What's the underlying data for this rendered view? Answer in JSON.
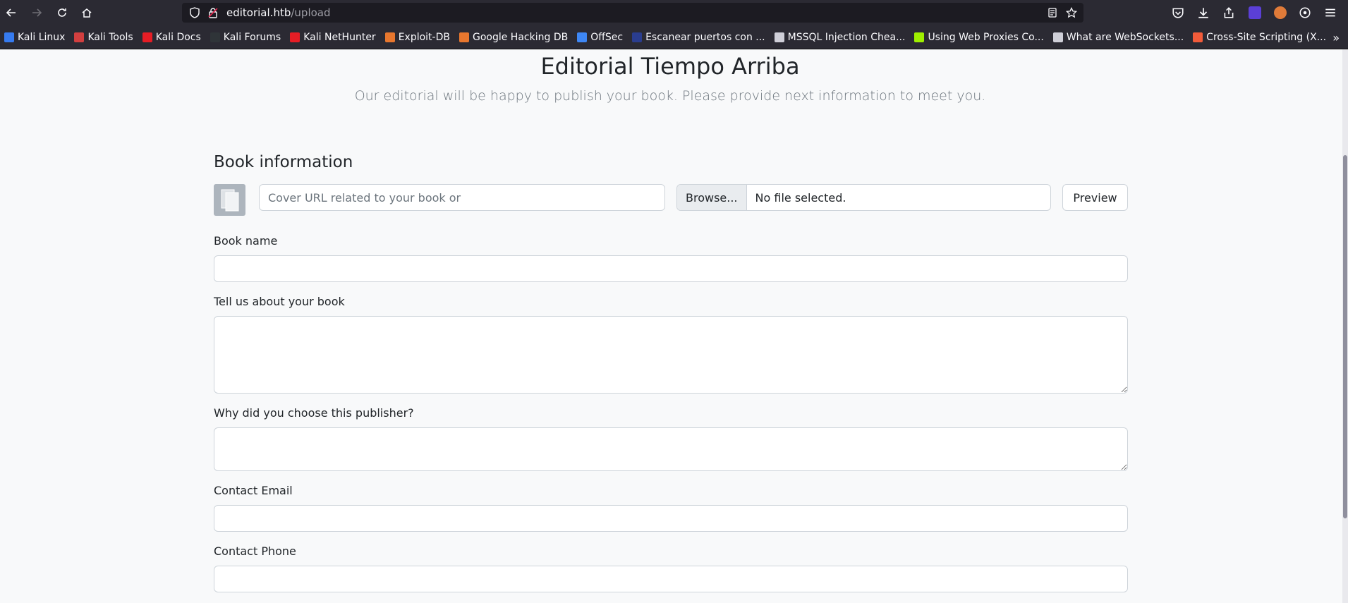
{
  "browser": {
    "url_host": "editorial.htb",
    "url_path": "/upload",
    "bookmarks": [
      {
        "label": "Kali Linux",
        "color": "#367bf0"
      },
      {
        "label": "Kali Tools",
        "color": "#d23f3f"
      },
      {
        "label": "Kali Docs",
        "color": "#e61d25"
      },
      {
        "label": "Kali Forums",
        "color": "#2f3438"
      },
      {
        "label": "Kali NetHunter",
        "color": "#e61d25"
      },
      {
        "label": "Exploit-DB",
        "color": "#e8772e"
      },
      {
        "label": "Google Hacking DB",
        "color": "#e8772e"
      },
      {
        "label": "OffSec",
        "color": "#3e87f5"
      },
      {
        "label": "Escanear puertos con ...",
        "color": "#2a3d8f"
      },
      {
        "label": "MSSQL Injection Chea...",
        "color": "#cfcfd8"
      },
      {
        "label": "Using Web Proxies Co...",
        "color": "#9fef00"
      },
      {
        "label": "What are WebSockets...",
        "color": "#cfcfd8"
      },
      {
        "label": "Cross-Site Scripting (X...",
        "color": "#f25b3a"
      }
    ]
  },
  "page": {
    "title": "Editorial Tiempo Arriba",
    "subtitle": "Our editorial will be happy to publish your book. Please provide next information to meet you.",
    "section_title": "Book information",
    "cover_url_placeholder": "Cover URL related to your book or",
    "browse_label": "Browse...",
    "file_status": "No file selected.",
    "preview_label": "Preview",
    "book_name_label": "Book name",
    "about_label": "Tell us about your book",
    "why_label": "Why did you choose this publisher?",
    "email_label": "Contact Email",
    "phone_label": "Contact Phone"
  }
}
